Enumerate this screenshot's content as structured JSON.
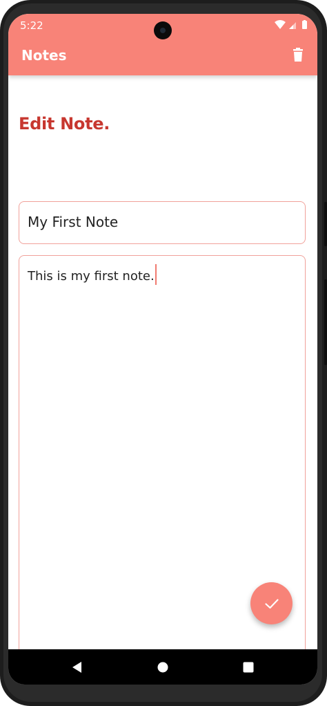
{
  "status_bar": {
    "time": "5:22",
    "icons": [
      "wifi-icon",
      "signal-icon",
      "battery-icon"
    ]
  },
  "app_bar": {
    "title": "Notes",
    "action_icon": "trash-icon"
  },
  "editor": {
    "heading": "Edit Note.",
    "title_value": "My First Note",
    "body_value": "This is my first note."
  },
  "fab": {
    "icon": "check-icon"
  },
  "nav_bar": {
    "icons": [
      "back-icon",
      "home-icon",
      "recents-icon"
    ]
  },
  "colors": {
    "accent": "#f88378",
    "heading": "#c7372f",
    "field_border": "#f1a19a",
    "text": "#222222"
  }
}
